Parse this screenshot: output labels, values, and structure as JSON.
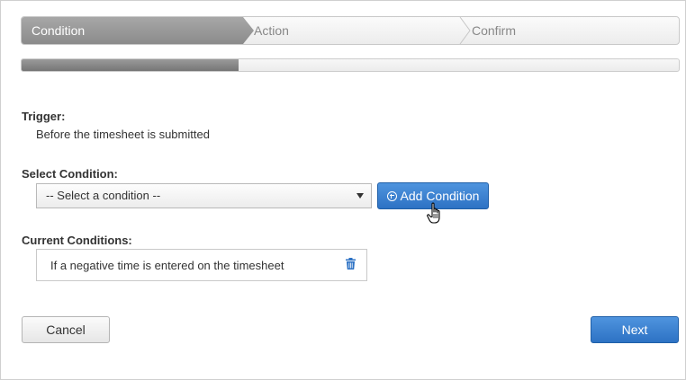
{
  "wizard": {
    "steps": [
      {
        "label": "Condition",
        "active": true
      },
      {
        "label": "Action",
        "active": false
      },
      {
        "label": "Confirm",
        "active": false
      }
    ],
    "progress_fraction": 0.33
  },
  "trigger": {
    "label": "Trigger:",
    "value": "Before the timesheet is submitted"
  },
  "select_condition": {
    "label": "Select Condition:",
    "selected": "-- Select a condition --",
    "add_button_label": "Add Condition",
    "add_icon": "plus-circle-icon"
  },
  "current_conditions": {
    "label": "Current Conditions:",
    "items": [
      {
        "text": "If a negative time is entered on the timesheet",
        "icon": "trash-icon"
      }
    ]
  },
  "footer": {
    "cancel_label": "Cancel",
    "next_label": "Next"
  },
  "colors": {
    "primary": "#2d72c4",
    "active_step": "#8b8b8b",
    "progress": "#767676"
  }
}
